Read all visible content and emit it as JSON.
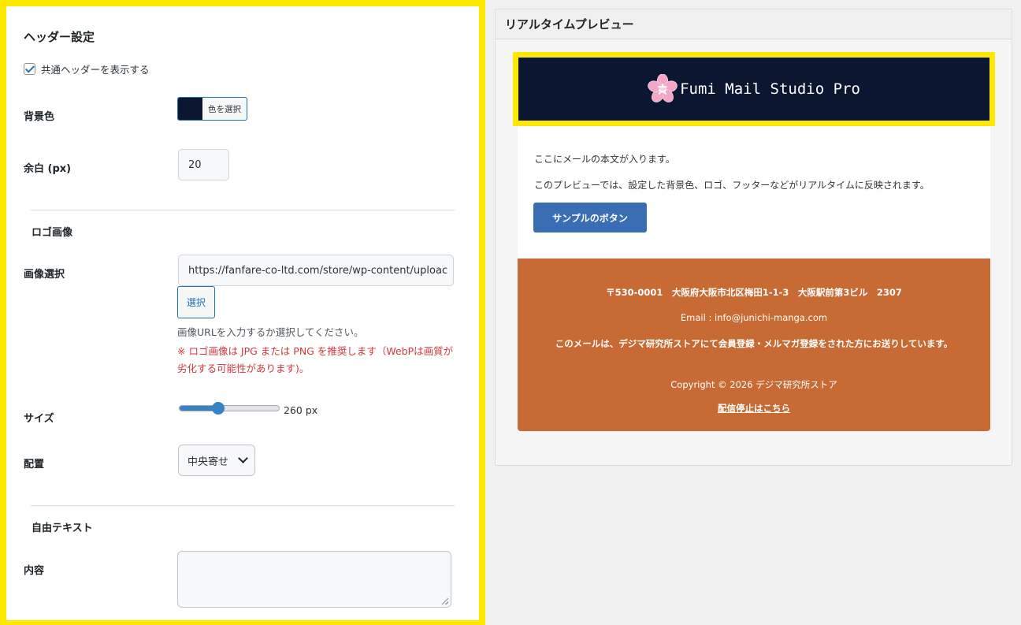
{
  "header_settings": {
    "title": "ヘッダー設定",
    "show_header_label": "共通ヘッダーを表示する",
    "show_header_checked": true,
    "bg_color": {
      "label": "背景色",
      "button_label": "色を選択",
      "value": "#0b1630"
    },
    "padding": {
      "label": "余白 (px)",
      "value": "20"
    }
  },
  "logo_section": {
    "title": "ロゴ画像",
    "image_label": "画像選択",
    "image_url": "https://fanfare-co-ltd.com/store/wp-content/uploac",
    "select_button": "選択",
    "help_text": "画像URLを入力するか選択してください。",
    "warning_text": "※ ロゴ画像は JPG または PNG を推奨します（WebPは画質が劣化する可能性があります)。",
    "size_label": "サイズ",
    "size_value_text": "260 px",
    "size_fraction": 0.39,
    "align_label": "配置",
    "align_value": "中央寄せ"
  },
  "free_text_section": {
    "title": "自由テキスト",
    "content_label": "内容",
    "content_value": ""
  },
  "preview": {
    "title": "リアルタイムプレビュー",
    "logo_text": "Fumi Mail Studio Pro",
    "logo_icon": "sakura-icon",
    "body_line1": "ここにメールの本文が入ります。",
    "body_line2": "このプレビューでは、設定した背景色、ロゴ、フッターなどがリアルタイムに反映されます。",
    "sample_button": "サンプルのボタン",
    "footer": {
      "address": "〒530-0001　大阪府大阪市北区梅田1-1-3　大阪駅前第3ビル　2307",
      "email": "Email : info@junichi-manga.com",
      "notice": "このメールは、デジマ研究所ストアにて会員登録・メルマガ登録をされた方にお送りしています。",
      "copyright": "Copyright © 2026 デジマ研究所ストア",
      "unsubscribe": "配信停止はこちら"
    }
  },
  "colors": {
    "highlight": "#ffe800",
    "header_bg": "#0b1630",
    "footer_bg": "#c86a33",
    "button_bg": "#3a6eb4",
    "warning": "#d63638"
  }
}
